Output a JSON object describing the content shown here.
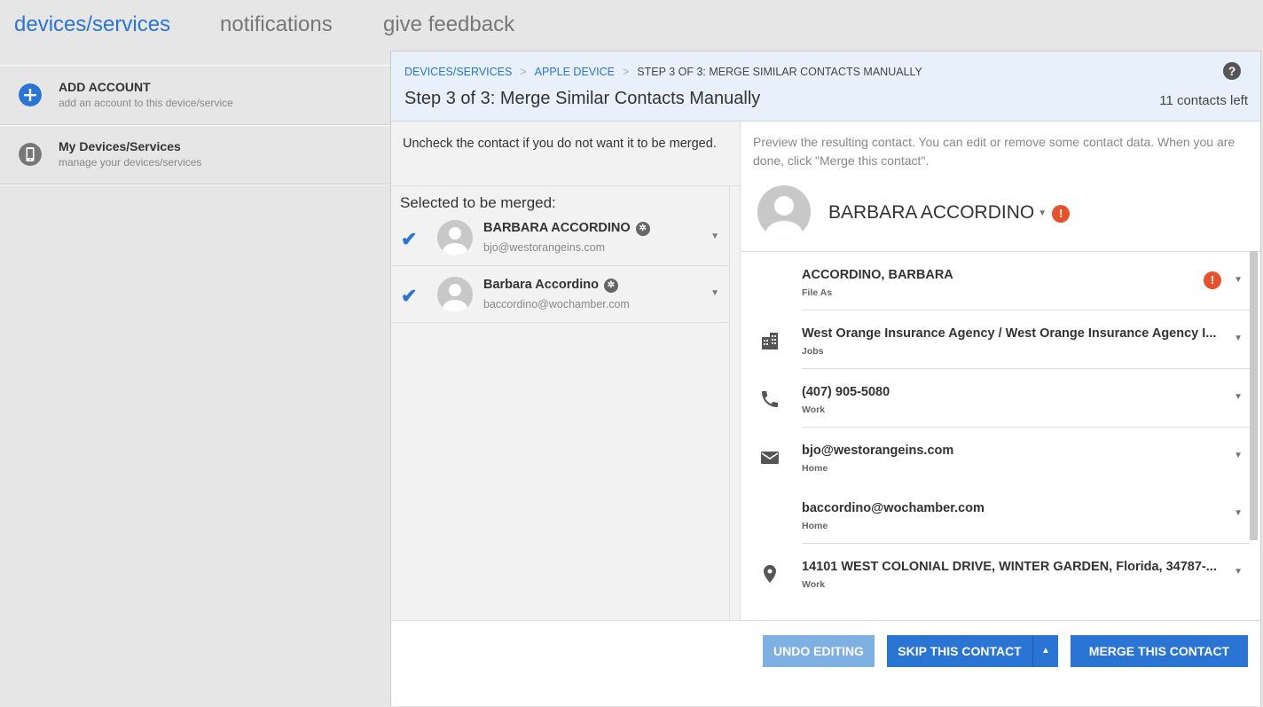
{
  "topnav": {
    "items": [
      "devices/services",
      "notifications",
      "give feedback"
    ],
    "active": "devices/services"
  },
  "sidebar": {
    "items": [
      {
        "title": "ADD ACCOUNT",
        "subtitle": "add an account to this device/service",
        "icon": "plus-circle-icon"
      },
      {
        "title": "My Devices/Services",
        "subtitle": "manage your devices/services",
        "icon": "phone-icon"
      }
    ]
  },
  "header": {
    "breadcrumb": [
      "DEVICES/SERVICES",
      "APPLE DEVICE",
      "STEP 3 OF 3: MERGE SIMILAR CONTACTS MANUALLY"
    ],
    "title": "Step 3 of 3: Merge Similar Contacts Manually",
    "contacts_left": "11 contacts left",
    "help": "?"
  },
  "left": {
    "instruction": "Uncheck the contact if you do not want it to be merged.",
    "selected_title": "Selected to be merged:",
    "contacts": [
      {
        "name": "BARBARA ACCORDINO",
        "email": "bjo@westorangeins.com",
        "checked": true
      },
      {
        "name": "Barbara Accordino",
        "email": "baccordino@wochamber.com",
        "checked": true
      }
    ]
  },
  "right": {
    "instruction": "Preview the resulting contact. You can edit or remove some contact data. When you are done, click \"Merge this contact\".",
    "name": "BARBARA ACCORDINO",
    "fields": [
      {
        "value": "ACCORDINO, BARBARA",
        "label": "File As",
        "icon": "",
        "warning": true
      },
      {
        "value": "West Orange Insurance Agency / West Orange Insurance Agency I...",
        "label": "Jobs",
        "icon": "building-icon",
        "warning": false
      },
      {
        "value": "(407) 905-5080",
        "label": "Work",
        "icon": "phone-icon",
        "warning": false
      },
      {
        "value": "bjo@westorangeins.com",
        "label": "Home",
        "icon": "mail-icon",
        "warning": false
      },
      {
        "value": "baccordino@wochamber.com",
        "label": "Home",
        "icon": "",
        "warning": false
      },
      {
        "value": "14101 WEST COLONIAL DRIVE, WINTER GARDEN, Florida, 34787-...",
        "label": "Work",
        "icon": "location-pin-icon",
        "warning": false
      }
    ]
  },
  "footer": {
    "undo": "UNDO EDITING",
    "skip": "SKIP THIS CONTACT",
    "merge": "MERGE THIS CONTACT"
  },
  "colors": {
    "accent": "#2a74d3",
    "warning": "#e5532d",
    "header_bg": "#e8f1fb"
  }
}
